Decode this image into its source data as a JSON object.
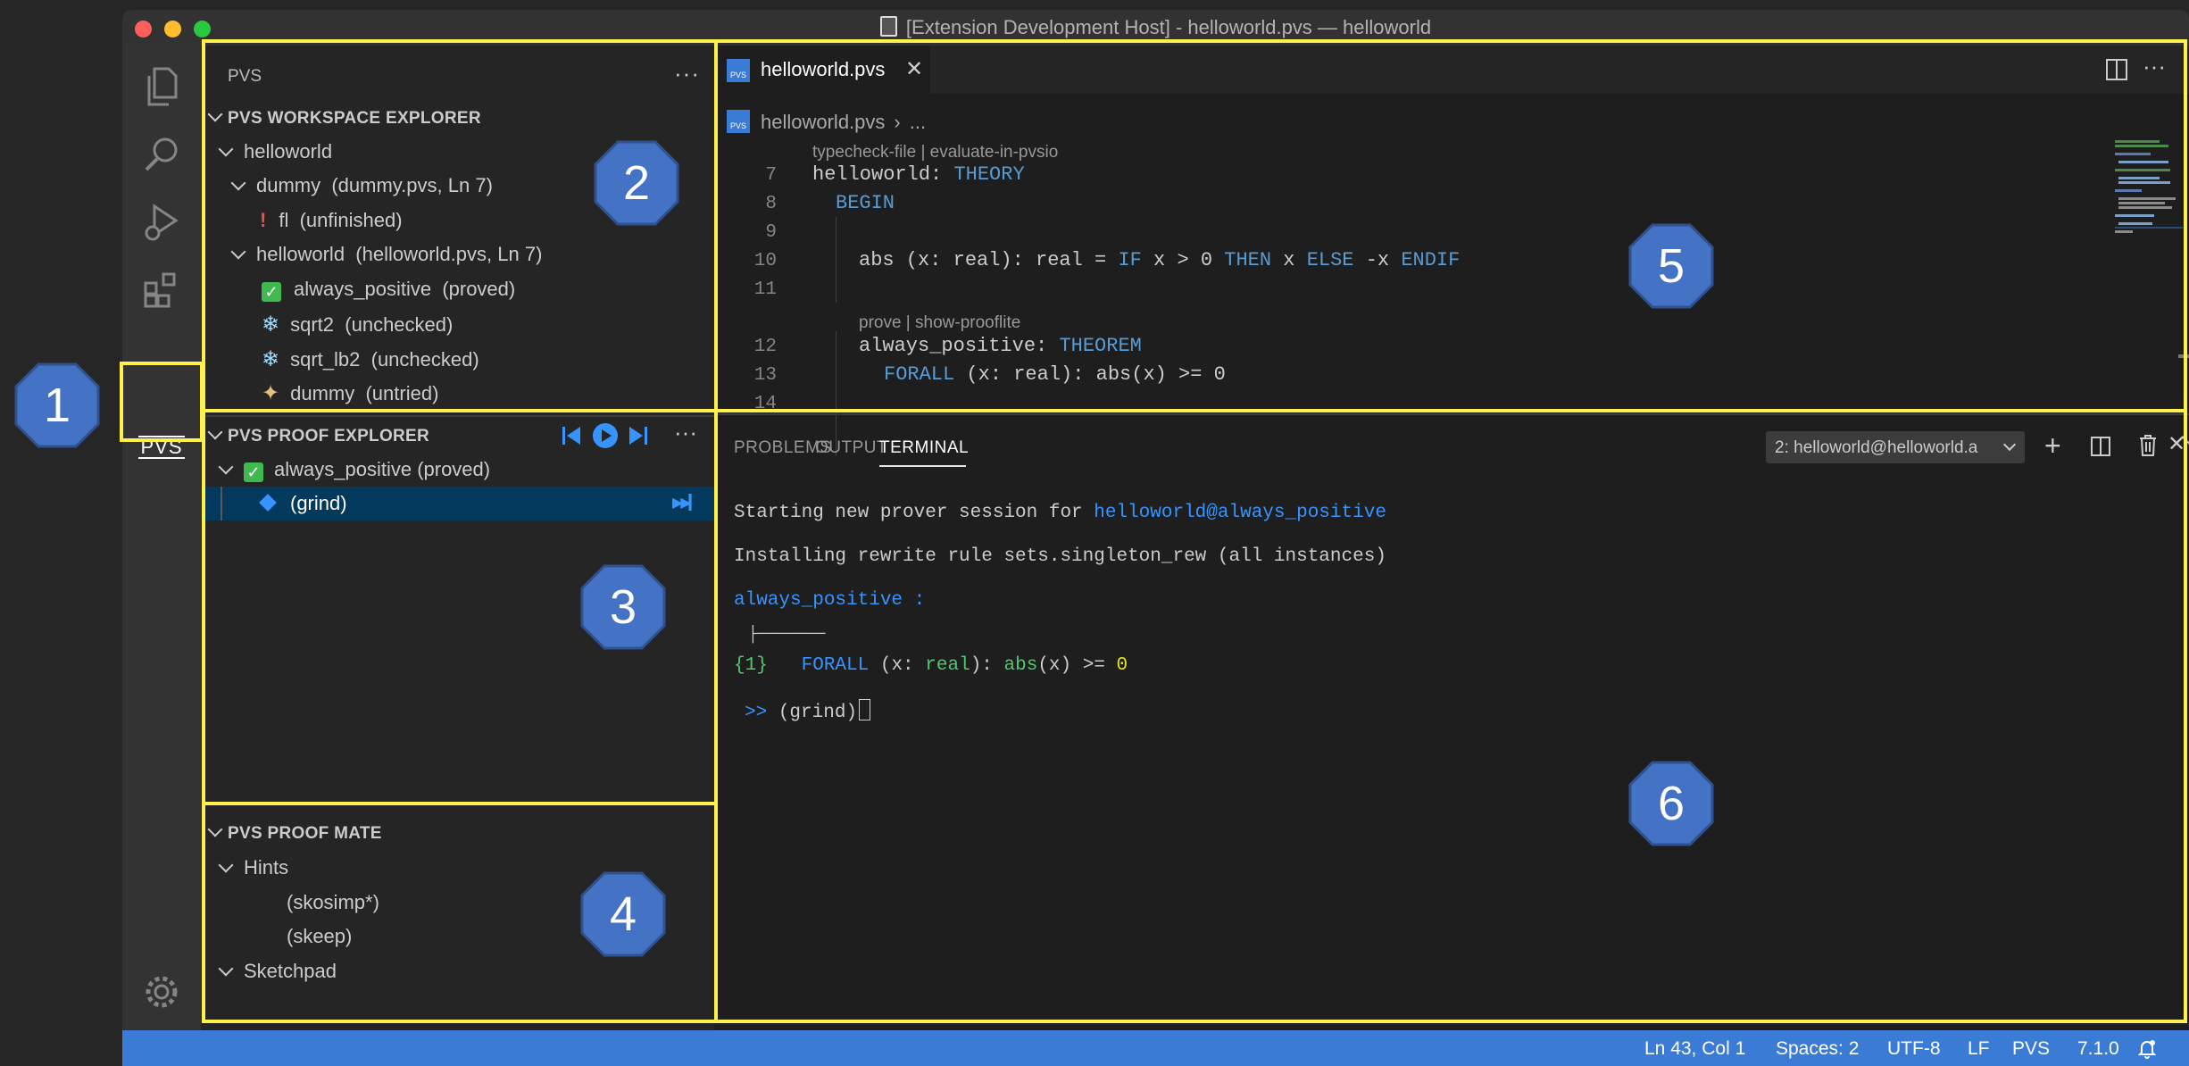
{
  "window": {
    "title": "[Extension Development Host] - helloworld.pvs — helloworld"
  },
  "activity_bar": {
    "pvs_label": "PVS"
  },
  "sidebar": {
    "title": "PVS",
    "workspace_explorer": {
      "header": "PVS WORKSPACE EXPLORER",
      "rows": [
        {
          "label": "helloworld",
          "detail": ""
        },
        {
          "label": "dummy",
          "detail": "(dummy.pvs, Ln 7)"
        },
        {
          "label": "fl",
          "detail": "(unfinished)"
        },
        {
          "label": "helloworld",
          "detail": "(helloworld.pvs, Ln 7)"
        },
        {
          "label": "always_positive",
          "detail": "(proved)"
        },
        {
          "label": "sqrt2",
          "detail": "(unchecked)"
        },
        {
          "label": "sqrt_lb2",
          "detail": "(unchecked)"
        },
        {
          "label": "dummy",
          "detail": "(untried)"
        }
      ]
    },
    "proof_explorer": {
      "header": "PVS PROOF EXPLORER",
      "root": "always_positive (proved)",
      "selected": "(grind)"
    },
    "proof_mate": {
      "header": "PVS PROOF MATE",
      "hints_label": "Hints",
      "hints": [
        "(skosimp*)",
        "(skeep)"
      ],
      "sketchpad_label": "Sketchpad"
    }
  },
  "editor": {
    "tab": "helloworld.pvs",
    "breadcrumb_file": "helloworld.pvs",
    "breadcrumb_more": "...",
    "file_icon_label": "PVS",
    "lens1": "typecheck-file | evaluate-in-pvsio",
    "lens2": "prove | show-prooflite",
    "lines": {
      "n7": "7",
      "n8": "8",
      "n9": "9",
      "n10": "10",
      "n11": "11",
      "n12": "12",
      "n13": "13",
      "n14": "14",
      "l7a": "helloworld: ",
      "l7b": "THEORY",
      "l8": "BEGIN",
      "l10a": "abs (x: real): real = ",
      "l10b": "IF",
      "l10c": " x > 0 ",
      "l10d": "THEN",
      "l10e": " x ",
      "l10f": "ELSE",
      "l10g": " -x ",
      "l10h": "ENDIF",
      "l12a": "always_positive: ",
      "l12b": "THEOREM",
      "l13a": "FORALL",
      "l13b": " (x: real): abs(x) >= 0"
    }
  },
  "panel": {
    "tabs": [
      "PROBLEMS",
      "OUTPUT",
      "TERMINAL"
    ],
    "terminal_selector": "2: helloworld@helloworld.a",
    "terminal": {
      "line1a": "Starting new prover session for ",
      "line1b": "helloworld@always_positive",
      "line2": "Installing rewrite rule sets.singleton_rew (all instances)",
      "line3": "always_positive :",
      "turnstile": "├───────",
      "seq_num": "{1}",
      "seq_forall": "FORALL",
      "seq_p1": " (x: ",
      "seq_real": "real",
      "seq_p2": "): ",
      "seq_abs": "abs",
      "seq_p3": "(x) >= ",
      "seq_zero": "0",
      "prompt": ">>",
      "input": "(grind)"
    }
  },
  "status_bar": {
    "position": "Ln 43, Col 1",
    "spaces": "Spaces: 2",
    "encoding": "UTF-8",
    "eol": "LF",
    "language": "PVS",
    "version": "7.1.0"
  },
  "callouts": {
    "c1": "1",
    "c2": "2",
    "c3": "3",
    "c4": "4",
    "c5": "5",
    "c6": "6"
  },
  "colors": {
    "highlight": "#fff14a",
    "callout": "#4472c4",
    "status": "#3a7bd5",
    "accent_blue": "#3794ff"
  }
}
